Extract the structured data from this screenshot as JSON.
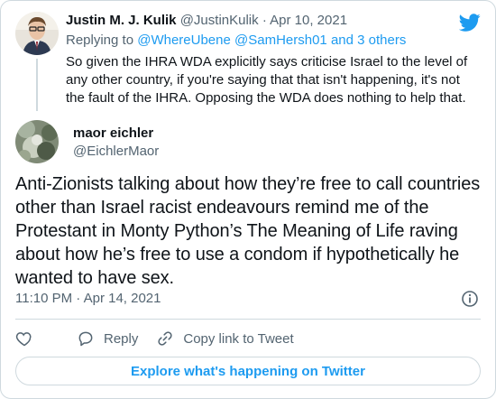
{
  "parent_tweet": {
    "name": "Justin M. J. Kulik",
    "handle": "@JustinKulik",
    "separator": "·",
    "date": "Apr 10, 2021",
    "replying_prefix": "Replying to",
    "replying_to_1": "@WhereUbene",
    "replying_to_2": "@SamHersh01",
    "replying_suffix": "and 3 others",
    "text": "So given the IHRA WDA explicitly says criticise Israel to the level of any other country, if you're saying that that isn't happening, it's not the fault of the IHRA. Opposing the WDA does nothing to help that."
  },
  "main_tweet": {
    "name": "maor eichler",
    "handle": "@EichlerMaor",
    "text": "Anti-Zionists talking about how they’re free to call countries other than Israel racist endeavours remind me of the Protestant in Monty Python’s The Meaning of Life raving about how he’s free to use a condom if hypothetically he wanted to have sex.",
    "timestamp": "11:10 PM · Apr 14, 2021"
  },
  "actions": {
    "reply_label": "Reply",
    "copy_link_label": "Copy link to Tweet"
  },
  "explore_label": "Explore what's happening on Twitter",
  "icons": {
    "brand": "twitter-bird-icon",
    "info": "info-icon",
    "like": "heart-icon",
    "reply": "reply-bubble-icon",
    "copy": "link-icon"
  },
  "colors": {
    "accent": "#1d9bf0",
    "text": "#0f1419",
    "muted": "#536471",
    "border": "#cfd9de"
  }
}
